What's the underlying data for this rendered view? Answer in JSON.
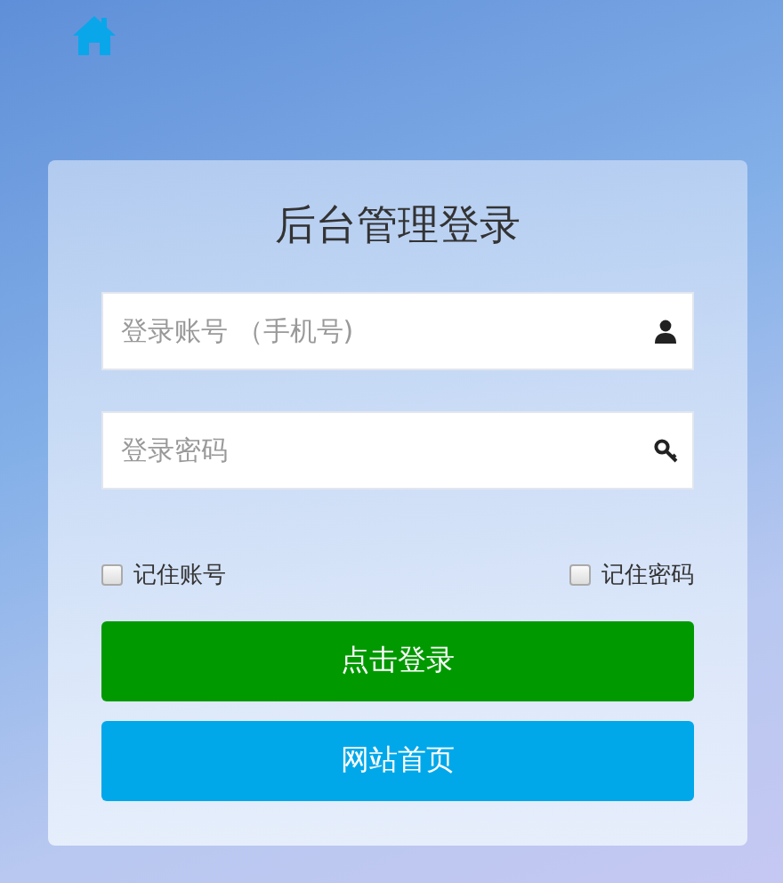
{
  "title": "后台管理登录",
  "fields": [
    {
      "kind": "user",
      "placeholder": "登录账号 （手机号)"
    },
    {
      "kind": "key",
      "placeholder": "登录密码"
    }
  ],
  "remember": [
    {
      "label": "记住账号",
      "checked": false
    },
    {
      "label": "记住密码",
      "checked": false
    }
  ],
  "buttons": [
    {
      "kind": "primary",
      "label": "点击登录"
    },
    {
      "kind": "secondary",
      "label": "网站首页"
    }
  ]
}
